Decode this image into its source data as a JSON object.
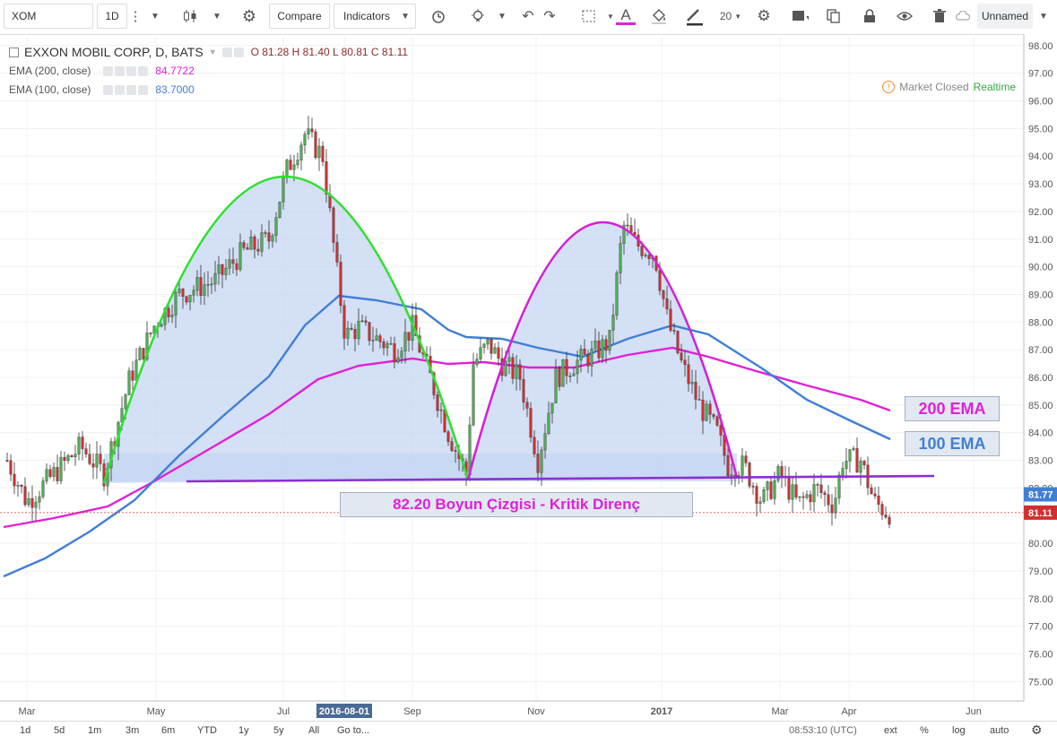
{
  "toolbar": {
    "symbol": "XOM",
    "interval": "1D",
    "compare_label": "Compare",
    "indicators_label": "Indicators",
    "font_size": "20",
    "layout_name": "Unnamed"
  },
  "legend": {
    "title": "EXXON MOBIL CORP, D, BATS",
    "ohlc": "O 81.28 H 81.40 L 80.81 C 81.11",
    "ema200_label": "EMA (200, close)",
    "ema200_value": "84.7722",
    "ema100_label": "EMA (100, close)",
    "ema100_value": "83.7000"
  },
  "status": {
    "market": "Market Closed",
    "realtime": "Realtime"
  },
  "annotations": {
    "neckline": "82.20 Boyun Çizgisi - Kritik Direnç",
    "ema200": "200 EMA",
    "ema100": "100 EMA"
  },
  "price_labels": {
    "ema_tag": "81.77",
    "last_tag": "81.11"
  },
  "time_labels": {
    "highlighted_date": "2016-08-01"
  },
  "bottom": {
    "ranges": [
      "1d",
      "5d",
      "1m",
      "3m",
      "6m",
      "YTD",
      "1y",
      "5y",
      "All"
    ],
    "goto": "Go to...",
    "time": "08:53:10 (UTC)",
    "options": [
      "ext",
      "%",
      "log",
      "auto"
    ]
  },
  "colors": {
    "ema200": "#e020d8",
    "ema100": "#3f7fd6",
    "green_arc": "#2fe02f",
    "magenta_arc": "#d321d3",
    "neckline": "#8a2fd0",
    "fill": "#c6d6f2",
    "up": "#4caf50",
    "down": "#d32f2f"
  },
  "chart_data": {
    "type": "candlestick",
    "title": "EXXON MOBIL CORP, D, BATS",
    "y_ticks": [
      75,
      76,
      77,
      78,
      79,
      80,
      81,
      82,
      83,
      84,
      85,
      86,
      87,
      88,
      89,
      90,
      91,
      92,
      93,
      94,
      95,
      96,
      97,
      98
    ],
    "ylim": [
      74.5,
      98.3
    ],
    "x_ticks": [
      "Mar",
      "May",
      "Jul",
      "2016-08-01",
      "Sep",
      "Nov",
      "2017",
      "Mar",
      "Apr",
      "Jun"
    ],
    "last_ohlc": {
      "open": 81.28,
      "high": 81.4,
      "low": 80.81,
      "close": 81.11
    },
    "neckline": 82.2,
    "series": [
      {
        "name": "EMA (200, close)",
        "last": 84.7722
      },
      {
        "name": "EMA (100, close)",
        "last": 83.7
      }
    ],
    "grid": true
  }
}
